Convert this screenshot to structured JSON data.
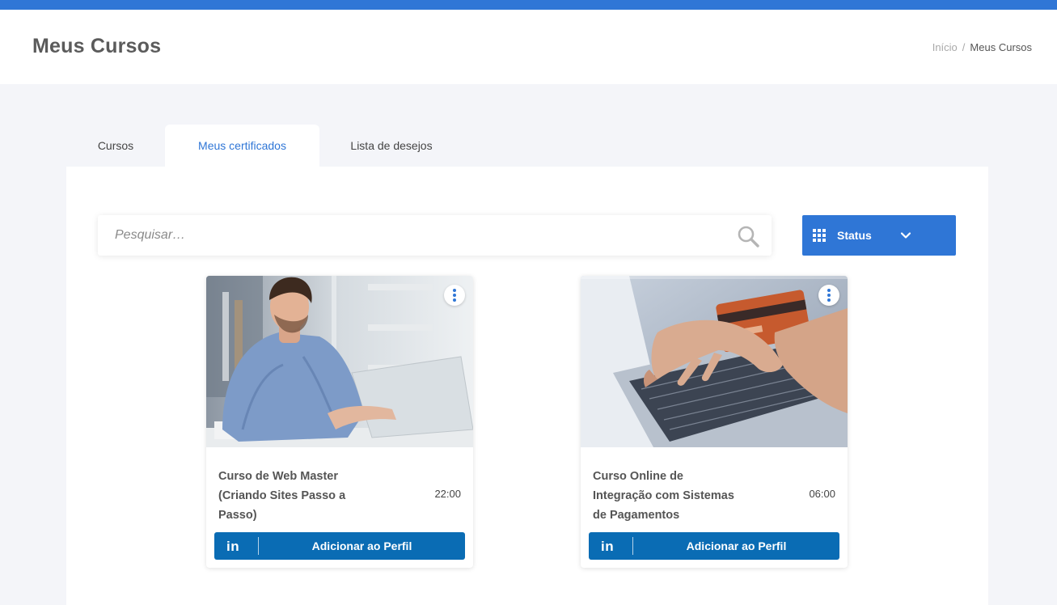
{
  "header": {
    "title": "Meus Cursos",
    "breadcrumb": {
      "home": "Início",
      "separator": "/",
      "current": "Meus Cursos"
    }
  },
  "tabs": [
    {
      "label": "Cursos",
      "active": false
    },
    {
      "label": "Meus certificados",
      "active": true
    },
    {
      "label": "Lista de desejos",
      "active": false
    }
  ],
  "search": {
    "placeholder": "Pesquisar…",
    "value": "",
    "icon": "search-icon"
  },
  "status_filter": {
    "label": "Status",
    "icon": "grid-icon",
    "dropdown_icon": "chevron-down-icon"
  },
  "courses": [
    {
      "title": "Curso de Web Master (Criando Sites Passo a Passo)",
      "duration": "22:00",
      "image": "man-using-laptop-photo",
      "action_label": "Adicionar ao Perfil",
      "action_icon": "linkedin-icon",
      "action_icon_text": "in"
    },
    {
      "title": "Curso Online de Integração com Sistemas de Pagamentos",
      "duration": "06:00",
      "image": "credit-card-laptop-photo",
      "action_label": "Adicionar ao Perfil",
      "action_icon": "linkedin-icon",
      "action_icon_text": "in"
    }
  ],
  "colors": {
    "accent": "#2f76d6",
    "linkedin": "#0a6cb4",
    "background": "#f4f5f9"
  }
}
